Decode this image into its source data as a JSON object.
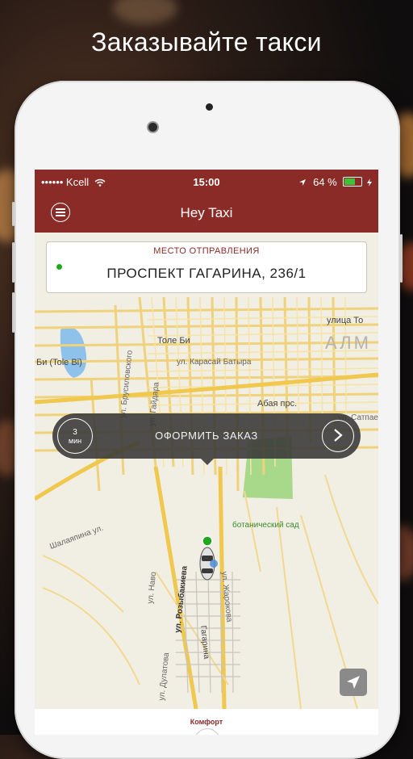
{
  "headline": "Заказывайте такси",
  "status_bar": {
    "carrier": "•••••• Kcell",
    "time": "15:00",
    "battery": "64 %"
  },
  "nav": {
    "title": "Hey Taxi"
  },
  "departure": {
    "label": "МЕСТО ОТПРАВЛЕНИЯ",
    "address": "ПРОСПЕКТ ГАГАРИНА, 236/1"
  },
  "order": {
    "eta_value": "3",
    "eta_unit": "мин",
    "label": "ОФОРМИТЬ ЗАКАЗ"
  },
  "map_labels": {
    "tole_bi": "Толе Би",
    "tole_bi_left": "Би (Tole Bi)",
    "karasay": "ул. Карасай Батыра",
    "abaya": "Абая прс.",
    "satpaev": "ул. Сатпае",
    "ulitsa_to": "улица То",
    "brusil": "ул. Брусиловского",
    "gaidar": "ул. Гайдара",
    "shalyapin": "Шалаяпина ул.",
    "nauryzbai": "ул. Наво",
    "rozybakieva": "ул. Розыбакиева",
    "gagarina": "Гагарина",
    "zharokova": "ул. Жарокова",
    "dulatova": "ул. Дулатова",
    "garden": "ботанический сад",
    "almaty": "АЛМ"
  },
  "bottom": {
    "tariff": "Комфорт"
  },
  "colors": {
    "brand": "#8b2b27",
    "accent_green": "#1fa81f"
  }
}
